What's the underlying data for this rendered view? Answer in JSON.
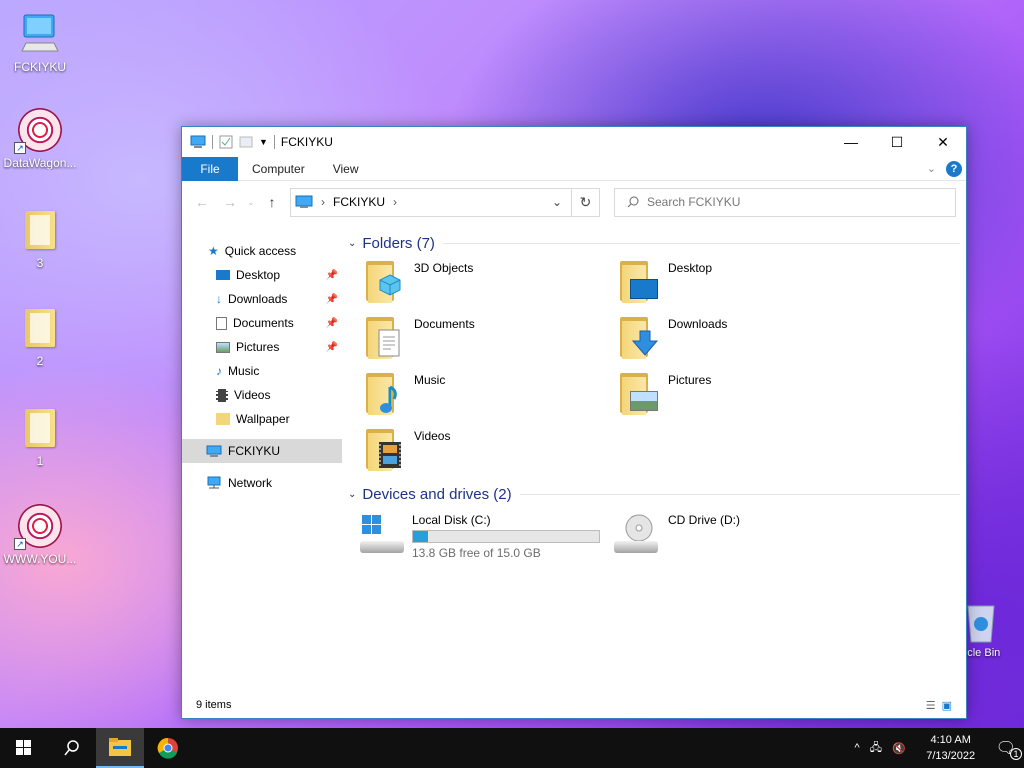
{
  "desktop": {
    "icons": [
      {
        "label": "FCKIYKU",
        "icon": "computer-icon"
      },
      {
        "label": "DataWagon...",
        "icon": "shortcut-icon"
      },
      {
        "label": "3",
        "icon": "folder-icon"
      },
      {
        "label": "2",
        "icon": "folder-icon"
      },
      {
        "label": "1",
        "icon": "folder-icon"
      },
      {
        "label": "WWW.YOU...",
        "icon": "shortcut-icon"
      }
    ],
    "recycle_bin": "ycle Bin"
  },
  "window": {
    "title": "FCKIYKU",
    "ribbon_tabs": [
      "File",
      "Computer",
      "View"
    ],
    "address": {
      "crumb": "FCKIYKU"
    },
    "search": {
      "placeholder": "Search FCKIYKU"
    },
    "nav": {
      "quick_access": "Quick access",
      "items": [
        {
          "label": "Desktop",
          "pinned": true
        },
        {
          "label": "Downloads",
          "pinned": true
        },
        {
          "label": "Documents",
          "pinned": true
        },
        {
          "label": "Pictures",
          "pinned": true
        },
        {
          "label": "Music",
          "pinned": false
        },
        {
          "label": "Videos",
          "pinned": false
        },
        {
          "label": "Wallpaper",
          "pinned": false
        }
      ],
      "this_pc": "FCKIYKU",
      "network": "Network"
    },
    "folders_header": "Folders (7)",
    "folders": [
      {
        "label": "3D Objects"
      },
      {
        "label": "Desktop"
      },
      {
        "label": "Documents"
      },
      {
        "label": "Downloads"
      },
      {
        "label": "Music"
      },
      {
        "label": "Pictures"
      },
      {
        "label": "Videos"
      }
    ],
    "devices_header": "Devices and drives (2)",
    "drives": [
      {
        "label": "Local Disk (C:)",
        "free_text": "13.8 GB free of 15.0 GB",
        "used_fraction": 0.08
      },
      {
        "label": "CD Drive (D:)"
      }
    ],
    "status": "9 items"
  },
  "taskbar": {
    "time": "4:10 AM",
    "date": "7/13/2022",
    "notification_count": "1"
  },
  "colors": {
    "accent": "#1979ca",
    "group_header": "#1e3287",
    "drive_bar": "#26a0da"
  }
}
